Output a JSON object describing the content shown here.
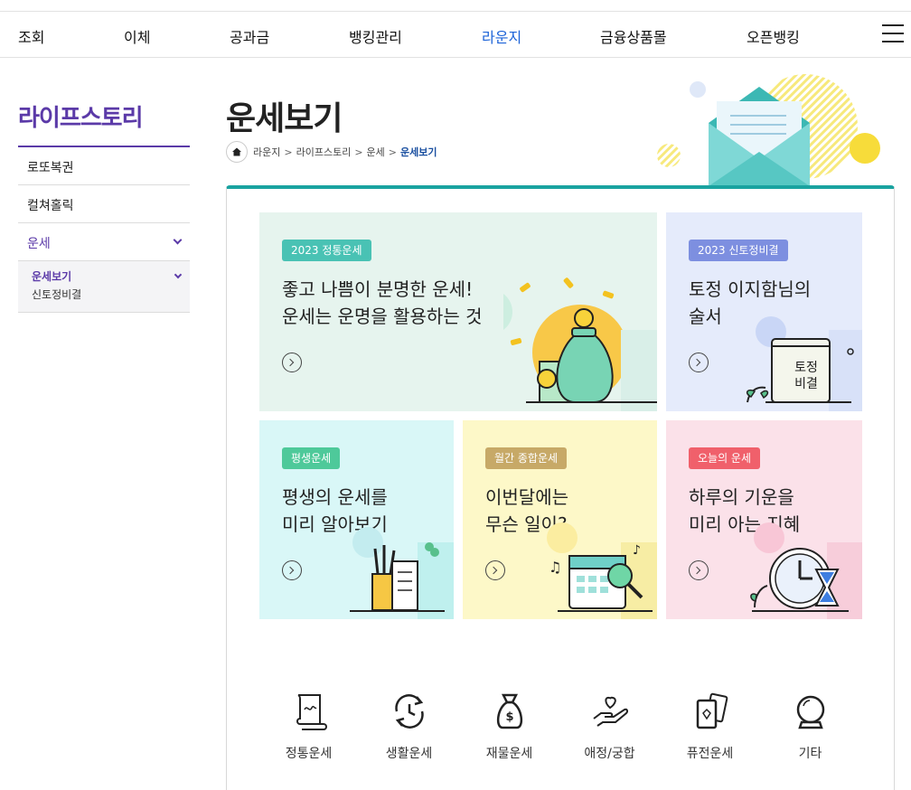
{
  "nav": {
    "items": [
      "조회",
      "이체",
      "공과금",
      "뱅킹관리",
      "라운지",
      "금융상품몰",
      "오픈뱅킹"
    ],
    "active_index": 4
  },
  "sidebar": {
    "title": "라이프스토리",
    "items": [
      "로또복권",
      "컬쳐홀릭",
      "운세"
    ],
    "sub_items": [
      "운세보기",
      "신토정비결"
    ]
  },
  "page": {
    "title": "운세보기",
    "breadcrumb": [
      "라운지",
      "라이프스토리",
      "운세",
      "운세보기"
    ]
  },
  "cards": [
    {
      "badge": "2023 정통운세",
      "line1": "좋고 나쁨이 분명한 운세!",
      "line2": "운세는 운명을 활용하는 것",
      "bg": "#e6f4ee",
      "badge_color": "#49c2b4"
    },
    {
      "badge": "2023 신토정비결",
      "line1": "토정 이지함님의",
      "line2": "술서",
      "bg": "#e5ebfb",
      "badge_color": "#7d8fe0",
      "book_text": [
        "토정",
        "비결"
      ]
    },
    {
      "badge": "평생운세",
      "line1": "평생의 운세를",
      "line2": "미리 알아보기",
      "bg": "#d9f7f7",
      "badge_color": "#4ec99a"
    },
    {
      "badge": "월간 종합운세",
      "line1": "이번달에는",
      "line2": "무슨 일이?",
      "bg": "#fdf8c8",
      "badge_color": "#c7a967"
    },
    {
      "badge": "오늘의 운세",
      "line1": "하루의 기운을",
      "line2": "미리 아는 지혜",
      "bg": "#fbe1e9",
      "badge_color": "#f0606b"
    }
  ],
  "categories": [
    "정통운세",
    "생활운세",
    "재물운세",
    "애정/궁합",
    "퓨전운세",
    "기타"
  ],
  "colors": {
    "accent": "#5b3aa8",
    "nav_active": "#1c63d8",
    "panel_top": "#1aa3a0"
  }
}
